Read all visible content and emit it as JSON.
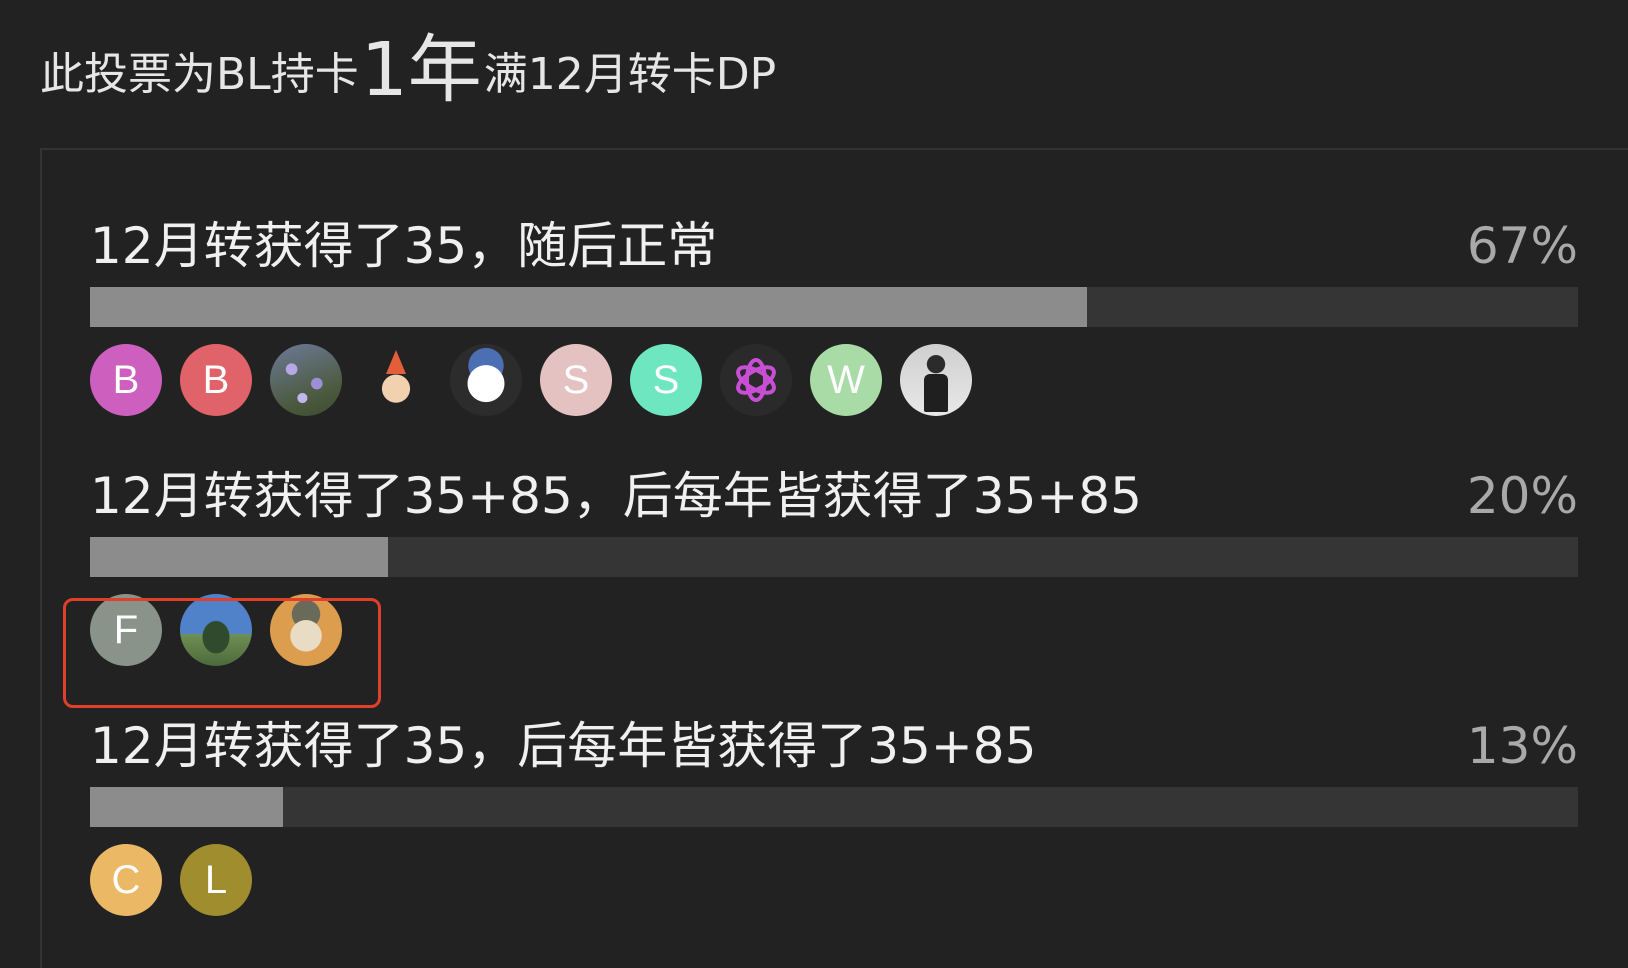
{
  "title": {
    "prefix": "此投票为BL持卡",
    "big": "1年",
    "suffix": "满12月转卡DP"
  },
  "options": [
    {
      "label": "12月转获得了35，随后正常",
      "percent_text": "67%",
      "percent": 67,
      "voters": [
        {
          "type": "letter",
          "letter": "B",
          "color": "#cd5fbf"
        },
        {
          "type": "letter",
          "letter": "B",
          "color": "#e0636a"
        },
        {
          "type": "photo",
          "icon": "flowers-photo-avatar"
        },
        {
          "type": "photo",
          "icon": "baby-party-hat-avatar"
        },
        {
          "type": "photo",
          "icon": "cartoon-character-avatar"
        },
        {
          "type": "letter",
          "letter": "S",
          "color": "#e5c2c2"
        },
        {
          "type": "letter",
          "letter": "S",
          "color": "#6ee6bf"
        },
        {
          "type": "photo",
          "icon": "openai-logo-avatar"
        },
        {
          "type": "letter",
          "letter": "W",
          "color": "#a8dba6"
        },
        {
          "type": "photo",
          "icon": "person-photo-avatar"
        }
      ]
    },
    {
      "label": "12月转获得了35+85，后每年皆获得了35+85",
      "percent_text": "20%",
      "percent": 20,
      "voters": [
        {
          "type": "letter",
          "letter": "F",
          "color": "#8a938a"
        },
        {
          "type": "photo",
          "icon": "tree-sky-photo-avatar"
        },
        {
          "type": "photo",
          "icon": "ape-nft-avatar"
        }
      ]
    },
    {
      "label": "12月转获得了35，后每年皆获得了35+85",
      "percent_text": "13%",
      "percent": 13,
      "voters": [
        {
          "type": "letter",
          "letter": "C",
          "color": "#ebb865"
        },
        {
          "type": "letter",
          "letter": "L",
          "color": "#9f8d2e"
        }
      ]
    }
  ],
  "colors": {
    "background": "#222222",
    "bar_fill": "#8c8c8c",
    "bar_track": "#353535",
    "highlight": "#e0402a"
  }
}
